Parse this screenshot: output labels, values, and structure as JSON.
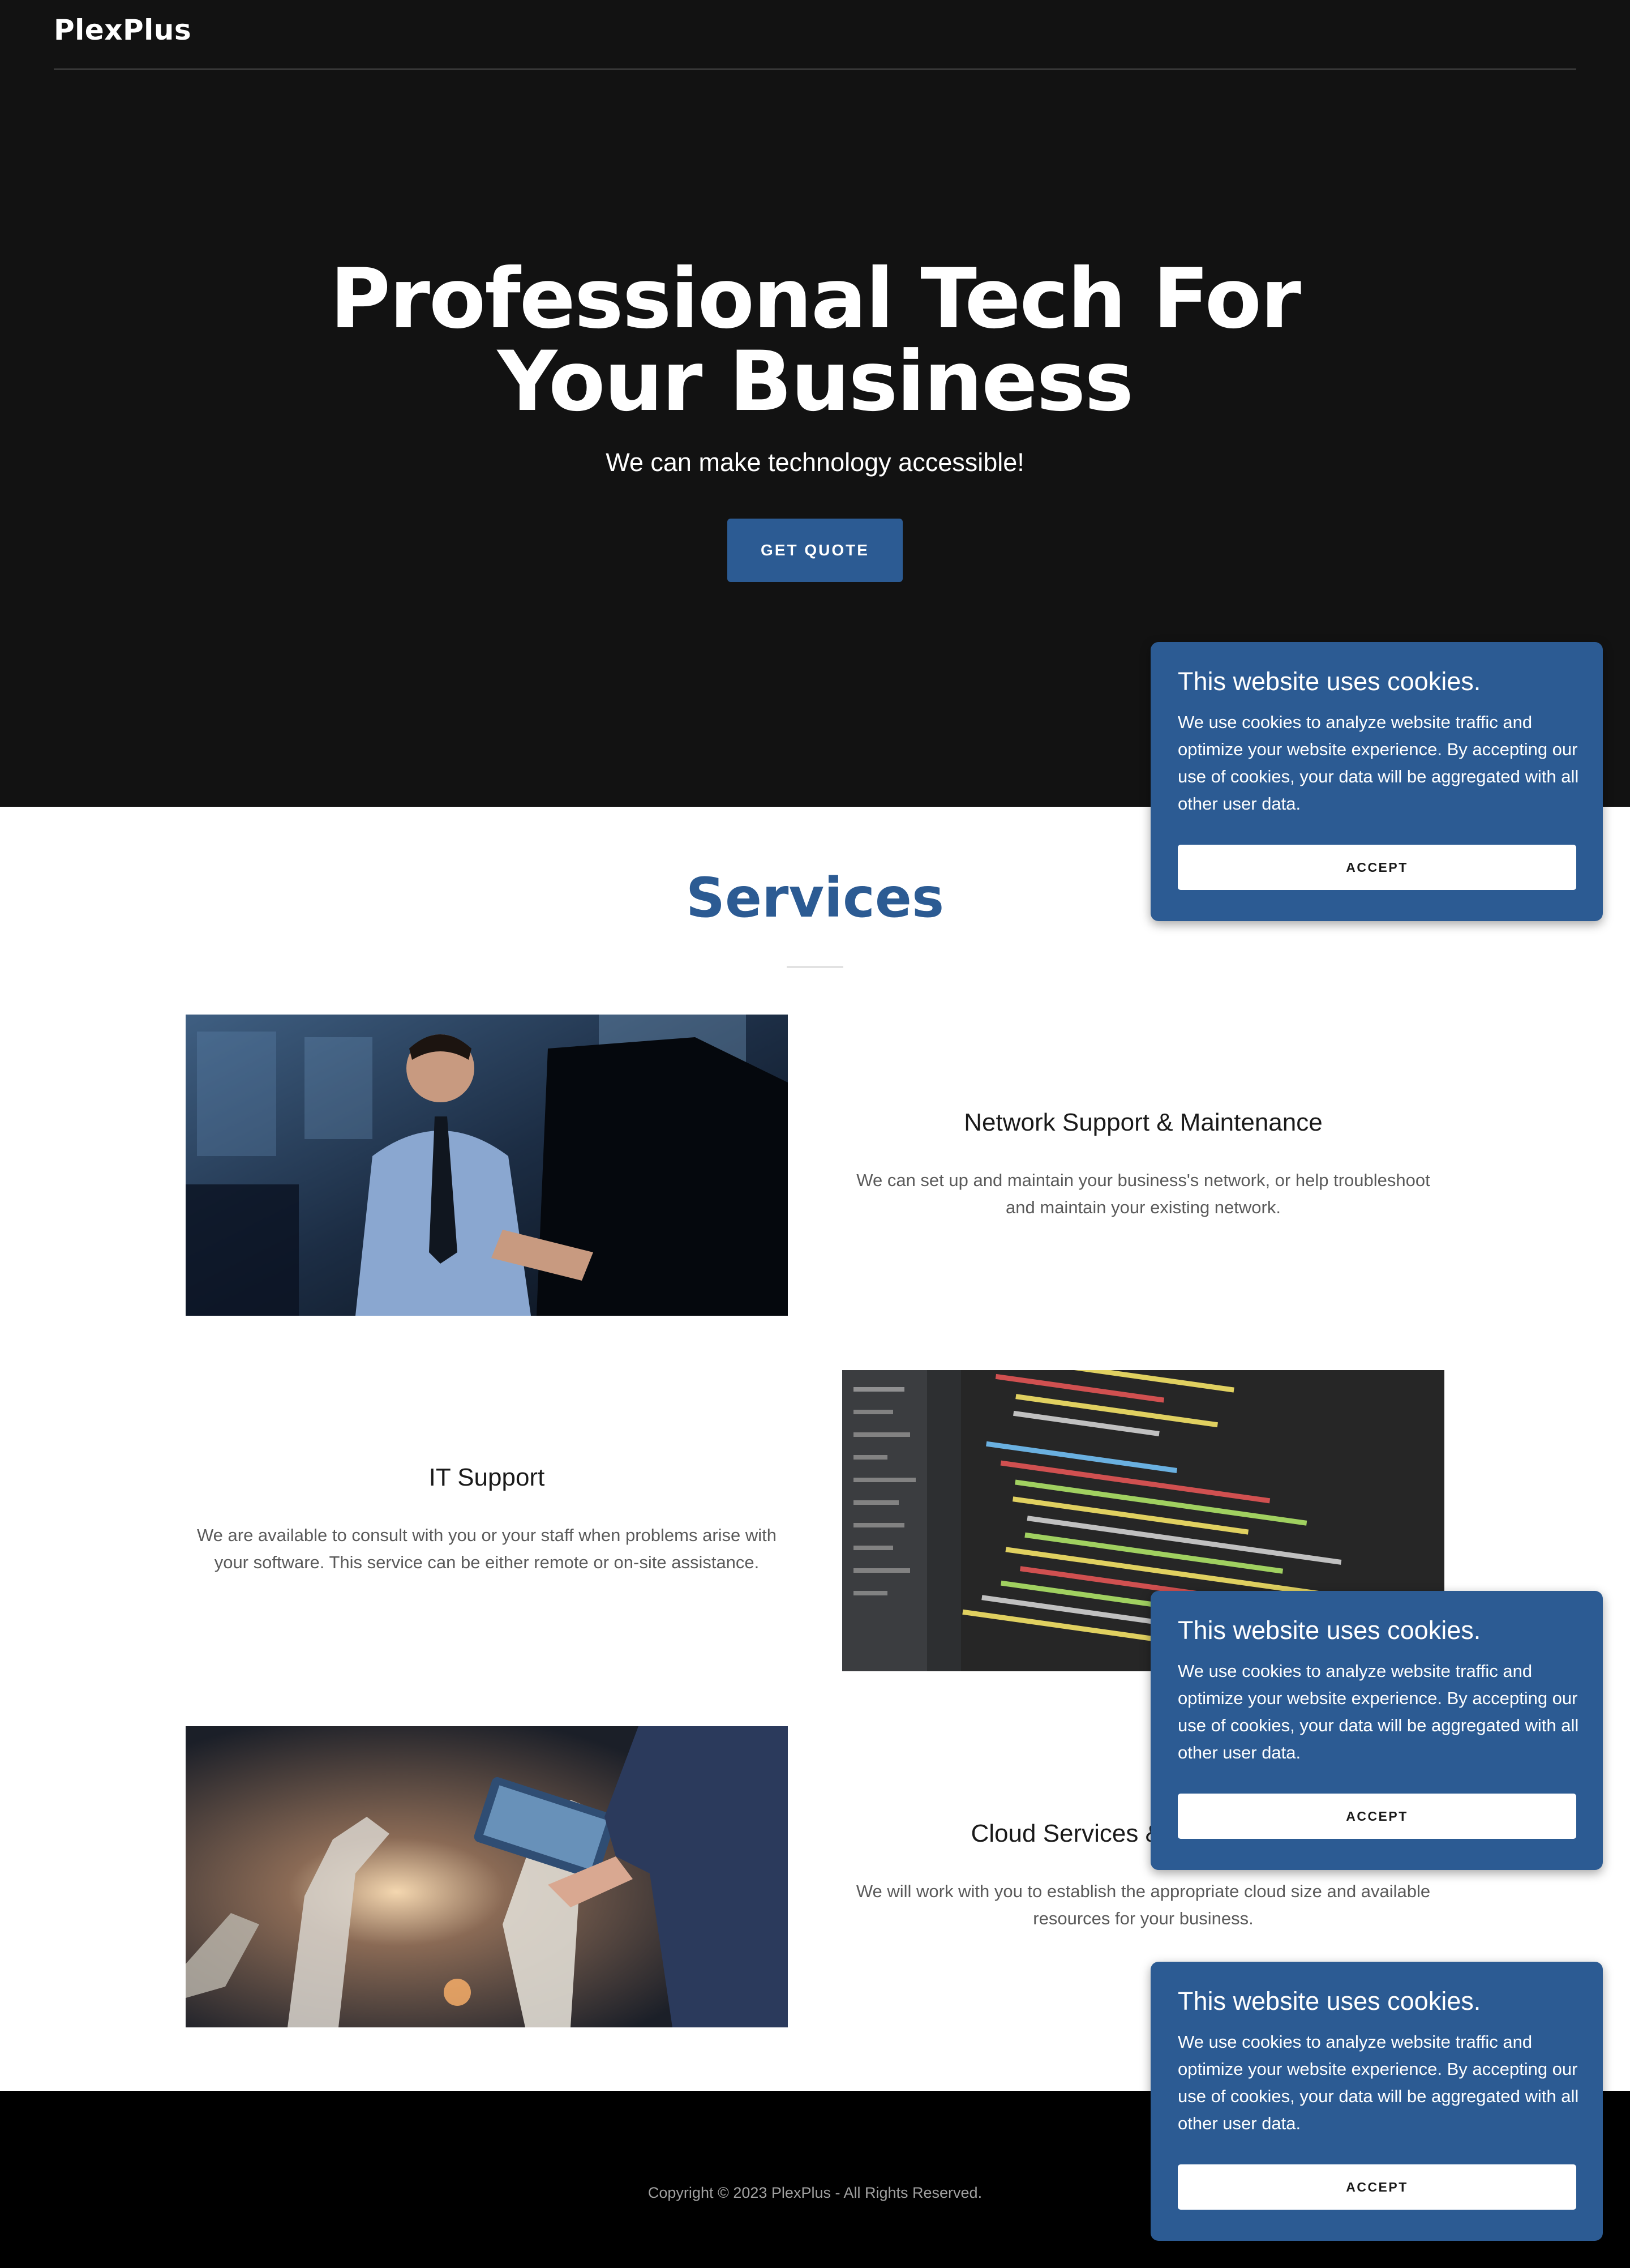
{
  "brand": {
    "logo": "PlexPlus"
  },
  "hero": {
    "title": "Professional Tech For Your Business",
    "subtitle": "We can make technology accessible!",
    "cta_label": "GET QUOTE"
  },
  "services": {
    "title": "Services",
    "items": [
      {
        "heading": "Network Support & Maintenance",
        "description": "We can set up and maintain your business's network, or help troubleshoot and maintain your existing network."
      },
      {
        "heading": "IT Support",
        "description": "We are available to consult with you or your staff when problems arise with your software. This service can be either remote or on-site assistance."
      },
      {
        "heading": "Cloud Services & Data Storage",
        "description": "We will work with you to establish the appropriate cloud size and available resources for your business."
      }
    ]
  },
  "footer": {
    "copyright": "Copyright © 2023 PlexPlus - All Rights Reserved."
  },
  "cookie_banner": {
    "title": "This website uses cookies.",
    "text": "We use cookies to analyze website traffic and optimize your website experience. By accepting our use of cookies, your data will be aggregated with all other user data.",
    "accept_label": "ACCEPT"
  },
  "colors": {
    "hero_bg": "#121212",
    "accent": "#2c5b93",
    "footer_bg": "#000000",
    "body_text": "#5a5a5a"
  }
}
